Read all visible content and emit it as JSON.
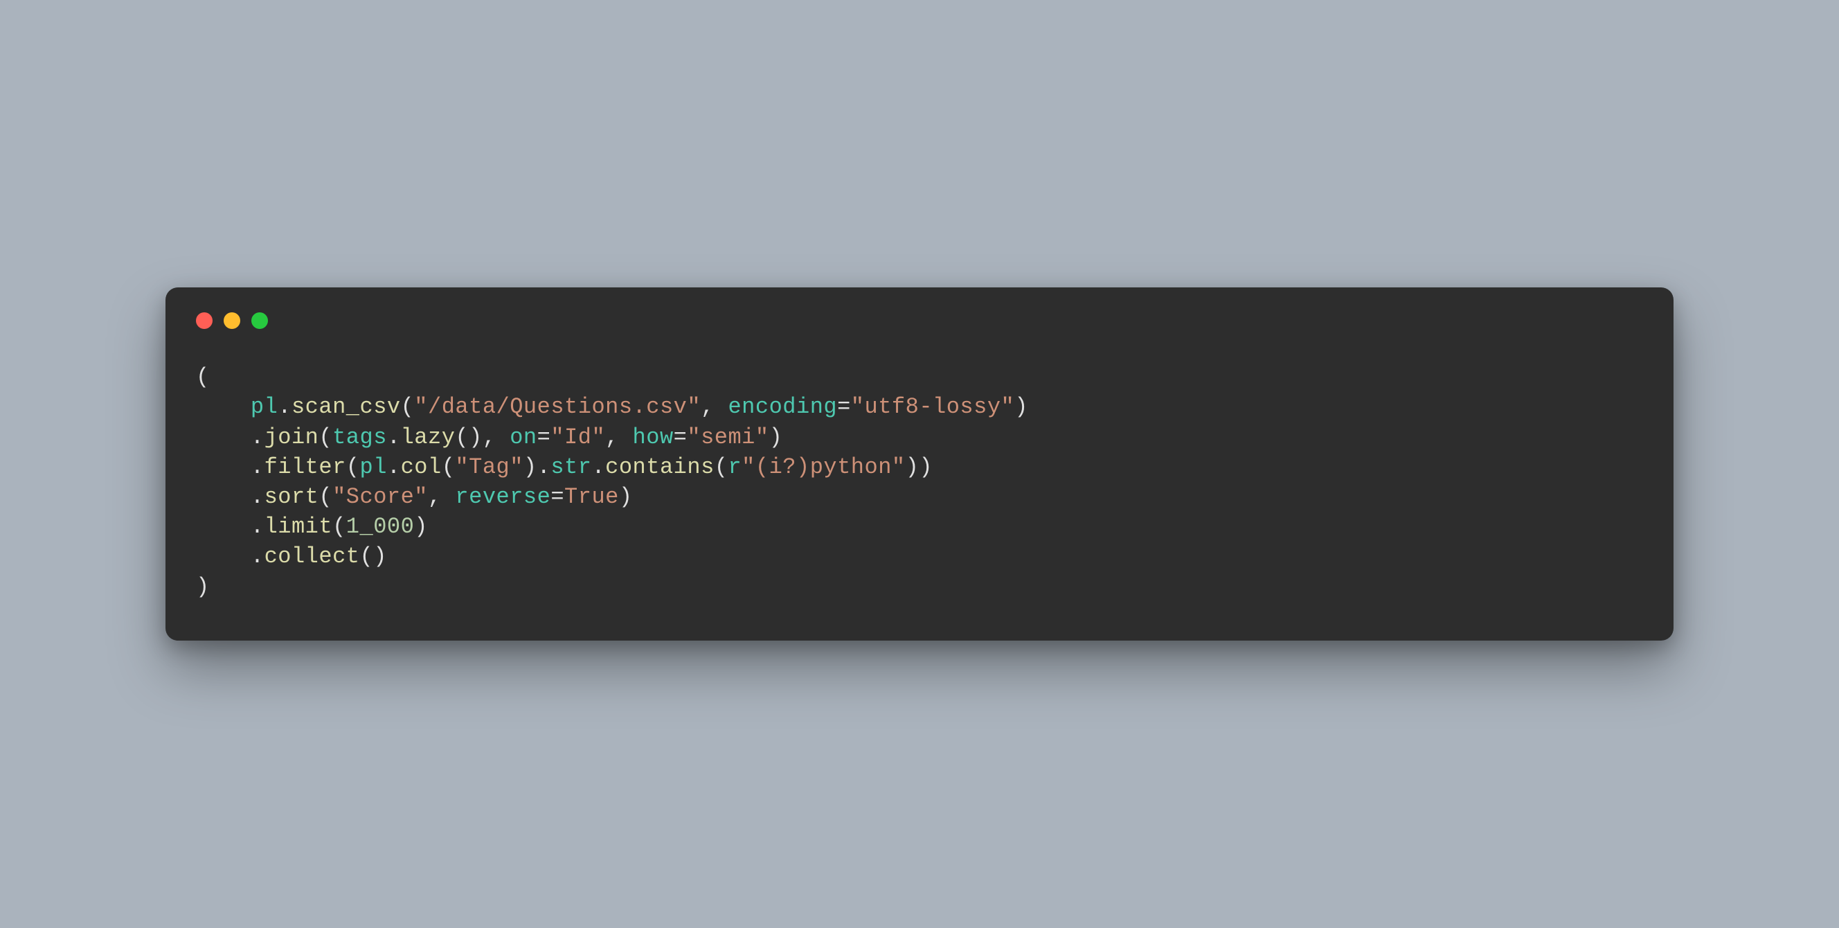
{
  "colors": {
    "background": "#aab3bd",
    "card": "#2d2d2d",
    "close": "#ff5f56",
    "min": "#ffbd2e",
    "max": "#27c93f",
    "punct": "#e0e0e0",
    "ident": "#d4d4d4",
    "obj": "#4ec9b0",
    "func": "#dcdcaa",
    "string": "#ce9178",
    "number": "#b5cea8"
  },
  "code": {
    "language": "python",
    "lines": [
      [
        {
          "t": "(",
          "c": "punct"
        }
      ],
      [
        {
          "t": "    ",
          "c": "ident"
        },
        {
          "t": "pl",
          "c": "obj"
        },
        {
          "t": ".",
          "c": "punct"
        },
        {
          "t": "scan_csv",
          "c": "func"
        },
        {
          "t": "(",
          "c": "punct"
        },
        {
          "t": "\"/data/Questions.csv\"",
          "c": "string"
        },
        {
          "t": ", ",
          "c": "punct"
        },
        {
          "t": "encoding",
          "c": "kwarg"
        },
        {
          "t": "=",
          "c": "punct"
        },
        {
          "t": "\"utf8-lossy\"",
          "c": "string"
        },
        {
          "t": ")",
          "c": "punct"
        }
      ],
      [
        {
          "t": "    .",
          "c": "punct"
        },
        {
          "t": "join",
          "c": "func"
        },
        {
          "t": "(",
          "c": "punct"
        },
        {
          "t": "tags",
          "c": "obj"
        },
        {
          "t": ".",
          "c": "punct"
        },
        {
          "t": "lazy",
          "c": "func"
        },
        {
          "t": "(), ",
          "c": "punct"
        },
        {
          "t": "on",
          "c": "kwarg"
        },
        {
          "t": "=",
          "c": "punct"
        },
        {
          "t": "\"Id\"",
          "c": "string"
        },
        {
          "t": ", ",
          "c": "punct"
        },
        {
          "t": "how",
          "c": "kwarg"
        },
        {
          "t": "=",
          "c": "punct"
        },
        {
          "t": "\"semi\"",
          "c": "string"
        },
        {
          "t": ")",
          "c": "punct"
        }
      ],
      [
        {
          "t": "    .",
          "c": "punct"
        },
        {
          "t": "filter",
          "c": "func"
        },
        {
          "t": "(",
          "c": "punct"
        },
        {
          "t": "pl",
          "c": "obj"
        },
        {
          "t": ".",
          "c": "punct"
        },
        {
          "t": "col",
          "c": "func"
        },
        {
          "t": "(",
          "c": "punct"
        },
        {
          "t": "\"Tag\"",
          "c": "string"
        },
        {
          "t": ").",
          "c": "punct"
        },
        {
          "t": "str",
          "c": "obj"
        },
        {
          "t": ".",
          "c": "punct"
        },
        {
          "t": "contains",
          "c": "func"
        },
        {
          "t": "(",
          "c": "punct"
        },
        {
          "t": "r",
          "c": "obj"
        },
        {
          "t": "\"(i?)python\"",
          "c": "string"
        },
        {
          "t": "))",
          "c": "punct"
        }
      ],
      [
        {
          "t": "    .",
          "c": "punct"
        },
        {
          "t": "sort",
          "c": "func"
        },
        {
          "t": "(",
          "c": "punct"
        },
        {
          "t": "\"Score\"",
          "c": "string"
        },
        {
          "t": ", ",
          "c": "punct"
        },
        {
          "t": "reverse",
          "c": "kwarg"
        },
        {
          "t": "=",
          "c": "punct"
        },
        {
          "t": "True",
          "c": "const"
        },
        {
          "t": ")",
          "c": "punct"
        }
      ],
      [
        {
          "t": "    .",
          "c": "punct"
        },
        {
          "t": "limit",
          "c": "func"
        },
        {
          "t": "(",
          "c": "punct"
        },
        {
          "t": "1_000",
          "c": "number"
        },
        {
          "t": ")",
          "c": "punct"
        }
      ],
      [
        {
          "t": "    .",
          "c": "punct"
        },
        {
          "t": "collect",
          "c": "func"
        },
        {
          "t": "()",
          "c": "punct"
        }
      ],
      [
        {
          "t": ")",
          "c": "punct"
        }
      ]
    ]
  }
}
